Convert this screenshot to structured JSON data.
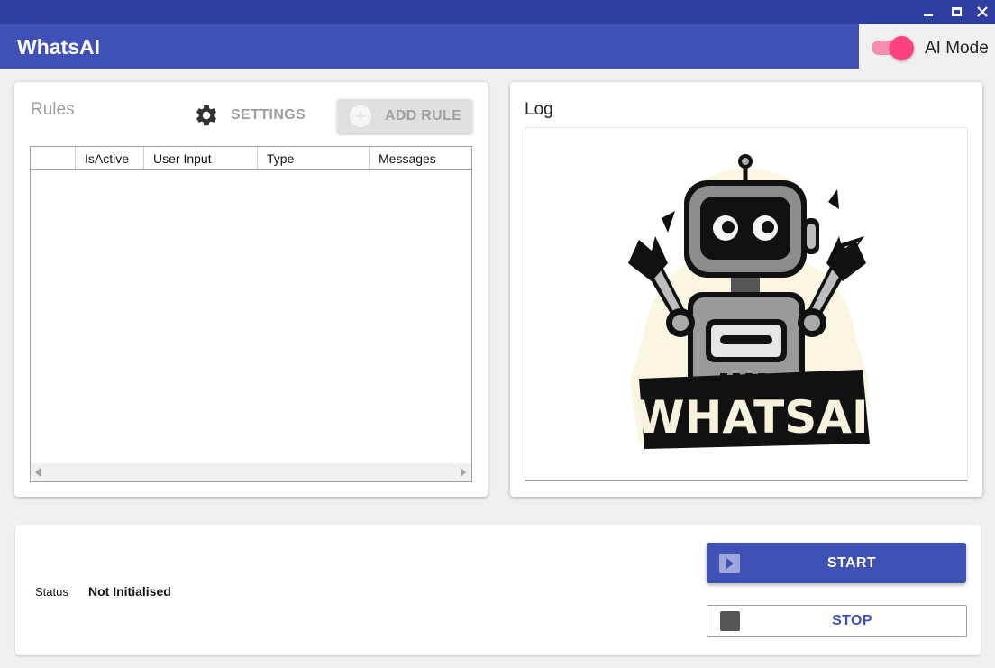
{
  "window": {
    "controls": [
      "minimize-icon",
      "maximize-icon",
      "close-icon"
    ],
    "close_glyph": "✕"
  },
  "app": {
    "title": "WhatsAI"
  },
  "ai_mode": {
    "label": "AI Mode",
    "enabled": true,
    "track_color": "#f48fb1",
    "knob_color": "#ff4081"
  },
  "rules": {
    "title": "Rules",
    "settings_label": "SETTINGS",
    "settings_icon": "gear-icon",
    "add_rule_label": "ADD RULE",
    "add_rule_icon": "plus-circle-icon",
    "columns": [
      "",
      "IsActive",
      "User Input",
      "Type",
      "Messages"
    ],
    "rows": []
  },
  "log": {
    "title": "Log",
    "logo_text": "WHATSAI"
  },
  "status": {
    "label": "Status",
    "value": "Not Initialised"
  },
  "actions": {
    "start_label": "START",
    "start_icon": "play-icon",
    "stop_label": "STOP",
    "stop_icon": "stop-icon"
  },
  "colors": {
    "titlebar": "#303f9f",
    "primary": "#3f51b5",
    "accent": "#ff4081",
    "background": "#f0f0f0"
  }
}
